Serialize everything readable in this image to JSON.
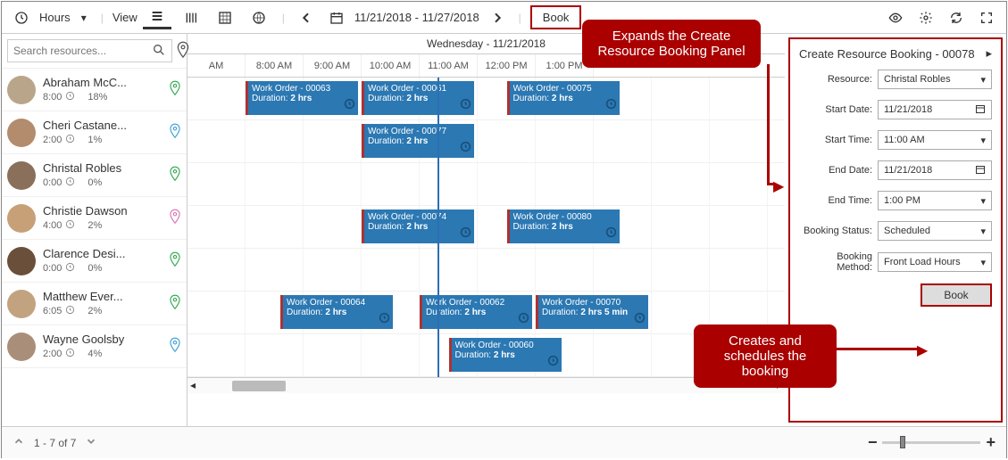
{
  "toolbar": {
    "mode_label": "Hours",
    "view_label": "View",
    "date_range": "11/21/2018 - 11/27/2018",
    "book_label": "Book"
  },
  "search": {
    "placeholder": "Search resources..."
  },
  "schedule": {
    "day_header": "Wednesday - 11/21/2018",
    "hours": [
      "AM",
      "8:00 AM",
      "9:00 AM",
      "10:00 AM",
      "11:00 AM",
      "12:00 PM",
      "1:00 PM"
    ]
  },
  "resources": [
    {
      "name": "Abraham McC...",
      "hours": "8:00",
      "pct": "18%",
      "pin": "#2fa84f",
      "avatar": "#b9a58a",
      "tasks": [
        {
          "title": "Work Order - 00063",
          "dur": "2 hrs",
          "start": 1,
          "span": 2
        },
        {
          "title": "Work Order - 00061",
          "dur": "2 hrs",
          "start": 3,
          "span": 2
        },
        {
          "title": "Work Order - 00075",
          "dur": "2 hrs",
          "start": 5.5,
          "span": 2
        }
      ]
    },
    {
      "name": "Cheri Castane...",
      "hours": "2:00",
      "pct": "1%",
      "pin": "#3aa0d6",
      "avatar": "#b38b6d",
      "tasks": [
        {
          "title": "Work Order - 00077",
          "dur": "2 hrs",
          "start": 3,
          "span": 2
        }
      ]
    },
    {
      "name": "Christal Robles",
      "hours": "0:00",
      "pct": "0%",
      "pin": "#2fa84f",
      "avatar": "#8a6f5a",
      "tasks": []
    },
    {
      "name": "Christie Dawson",
      "hours": "4:00",
      "pct": "2%",
      "pin": "#d673b7",
      "avatar": "#c8a078",
      "tasks": [
        {
          "title": "Work Order - 00074",
          "dur": "2 hrs",
          "start": 3,
          "span": 2
        },
        {
          "title": "Work Order - 00080",
          "dur": "2 hrs",
          "start": 5.5,
          "span": 2
        }
      ]
    },
    {
      "name": "Clarence Desi...",
      "hours": "0:00",
      "pct": "0%",
      "pin": "#2fa84f",
      "avatar": "#6a4f3b",
      "tasks": []
    },
    {
      "name": "Matthew Ever...",
      "hours": "6:05",
      "pct": "2%",
      "pin": "#2fa84f",
      "avatar": "#c2a380",
      "tasks": [
        {
          "title": "Work Order - 00064",
          "dur": "2 hrs",
          "start": 1.6,
          "span": 2
        },
        {
          "title": "Work Order - 00062",
          "dur": "2 hrs",
          "start": 4,
          "span": 2
        },
        {
          "title": "Work Order - 00070",
          "dur": "2 hrs 5 min",
          "start": 6,
          "span": 2
        }
      ]
    },
    {
      "name": "Wayne Goolsby",
      "hours": "2:00",
      "pct": "4%",
      "pin": "#3aa0d6",
      "avatar": "#a98f7a",
      "tasks": [
        {
          "title": "Work Order - 00060",
          "dur": "2 hrs",
          "start": 4.5,
          "span": 2
        }
      ]
    }
  ],
  "panel": {
    "title": "Create Resource Booking - 00078",
    "fields": {
      "resource_label": "Resource:",
      "resource_value": "Christal Robles",
      "startdate_label": "Start Date:",
      "startdate_value": "11/21/2018",
      "starttime_label": "Start Time:",
      "starttime_value": "11:00 AM",
      "enddate_label": "End Date:",
      "enddate_value": "11/21/2018",
      "endtime_label": "End Time:",
      "endtime_value": "1:00 PM",
      "status_label": "Booking Status:",
      "status_value": "Scheduled",
      "method_label": "Booking Method:",
      "method_value": "Front Load Hours"
    },
    "book_label": "Book"
  },
  "callouts": {
    "top": "Expands the Create Resource Booking Panel",
    "bottom": "Creates and schedules the booking"
  },
  "footer": {
    "range": "1 - 7 of 7"
  }
}
